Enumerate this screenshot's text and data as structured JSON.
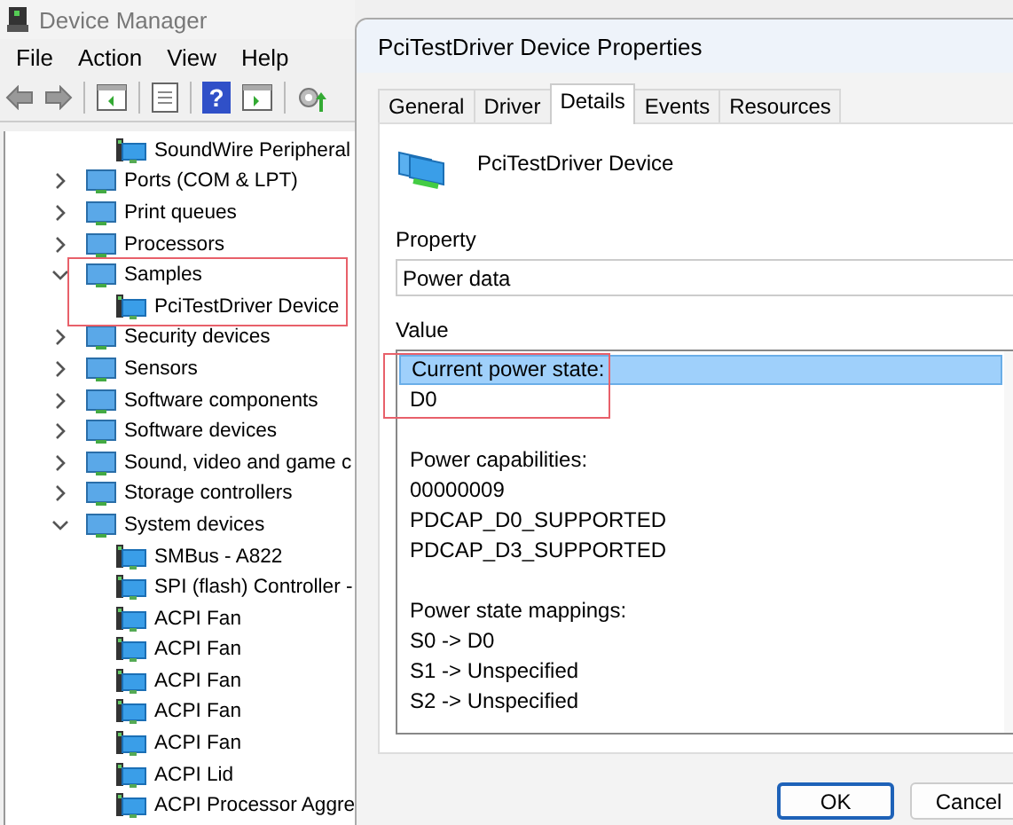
{
  "device_manager": {
    "title": "Device Manager",
    "menu": [
      "File",
      "Action",
      "View",
      "Help"
    ],
    "help_glyph": "?",
    "tree": [
      {
        "label": "SoundWire Peripheral",
        "kind": "device"
      },
      {
        "label": "Ports (COM & LPT)",
        "kind": "category",
        "expanded": false
      },
      {
        "label": "Print queues",
        "kind": "category",
        "expanded": false
      },
      {
        "label": "Processors",
        "kind": "category",
        "expanded": false
      },
      {
        "label": "Samples",
        "kind": "category",
        "expanded": true,
        "children": [
          {
            "label": "PciTestDriver Device",
            "kind": "device"
          }
        ]
      },
      {
        "label": "Security devices",
        "kind": "category",
        "expanded": false
      },
      {
        "label": "Sensors",
        "kind": "category",
        "expanded": false
      },
      {
        "label": "Software components",
        "kind": "category",
        "expanded": false
      },
      {
        "label": "Software devices",
        "kind": "category",
        "expanded": false
      },
      {
        "label": "Sound, video and game c",
        "kind": "category",
        "expanded": false
      },
      {
        "label": "Storage controllers",
        "kind": "category",
        "expanded": false
      },
      {
        "label": "System devices",
        "kind": "category",
        "expanded": true,
        "children": [
          {
            "label": "SMBus - A822",
            "kind": "device"
          },
          {
            "label": "SPI (flash) Controller -",
            "kind": "device"
          },
          {
            "label": "ACPI Fan",
            "kind": "device"
          },
          {
            "label": "ACPI Fan",
            "kind": "device"
          },
          {
            "label": "ACPI Fan",
            "kind": "device"
          },
          {
            "label": "ACPI Fan",
            "kind": "device"
          },
          {
            "label": "ACPI Fan",
            "kind": "device"
          },
          {
            "label": "ACPI Lid",
            "kind": "device"
          },
          {
            "label": "ACPI Processor Aggre",
            "kind": "device"
          }
        ]
      }
    ]
  },
  "dialog": {
    "title": "PciTestDriver Device Properties",
    "tabs": [
      {
        "label": "General",
        "selected": false
      },
      {
        "label": "Driver",
        "selected": false
      },
      {
        "label": "Details",
        "selected": true
      },
      {
        "label": "Events",
        "selected": false
      },
      {
        "label": "Resources",
        "selected": false
      }
    ],
    "device_name": "PciTestDriver Device",
    "property_label": "Property",
    "property": "Power data",
    "value_label": "Value",
    "value_sections": [
      [
        {
          "text": "Current power state:",
          "selected": true
        },
        {
          "text": "D0",
          "selected": false
        }
      ],
      [
        {
          "text": "Power capabilities:",
          "selected": false
        },
        {
          "text": "00000009",
          "selected": false
        },
        {
          "text": "PDCAP_D0_SUPPORTED",
          "selected": false
        },
        {
          "text": "PDCAP_D3_SUPPORTED",
          "selected": false
        }
      ],
      [
        {
          "text": "Power state mappings:",
          "selected": false
        },
        {
          "text": "S0 -> D0",
          "selected": false
        },
        {
          "text": "S1 -> Unspecified",
          "selected": false
        },
        {
          "text": "S2 -> Unspecified",
          "selected": false
        }
      ]
    ],
    "buttons": [
      {
        "label": "OK",
        "default": true
      },
      {
        "label": "Cancel",
        "default": false
      }
    ]
  }
}
